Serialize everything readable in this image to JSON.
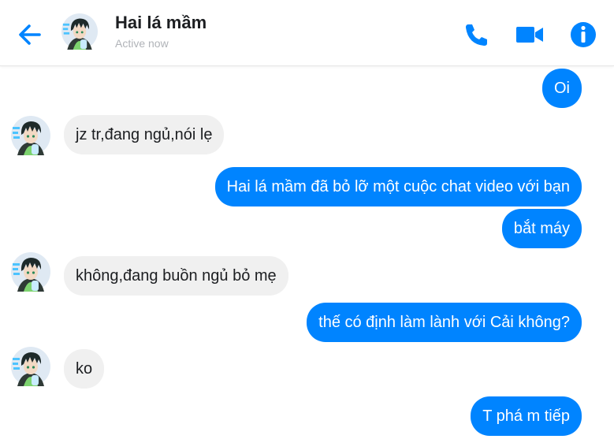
{
  "header": {
    "name": "Hai lá mầm",
    "status": "Active now"
  },
  "colors": {
    "accent": "#0084ff",
    "incoming_bubble": "#f0f0f0",
    "outgoing_text": "#ffffff",
    "incoming_text": "#1c1e21"
  },
  "messages": [
    {
      "sender": "me",
      "text": "Oi"
    },
    {
      "sender": "them",
      "text": "jz tr,đang ngủ,nói lẹ"
    },
    {
      "sender": "me",
      "text": "Hai lá mầm đã bỏ lỡ một cuộc chat video với bạn"
    },
    {
      "sender": "me",
      "text": "bắt máy"
    },
    {
      "sender": "them",
      "text": "không,đang buồn ngủ bỏ mẹ"
    },
    {
      "sender": "me",
      "text": "thế có định làm lành với Cải không?"
    },
    {
      "sender": "them",
      "text": "ko"
    },
    {
      "sender": "me",
      "text": "T phá m tiếp"
    }
  ],
  "icons": {
    "back": "arrow-left-icon",
    "call": "phone-icon",
    "video": "video-camera-icon",
    "info": "info-icon"
  }
}
